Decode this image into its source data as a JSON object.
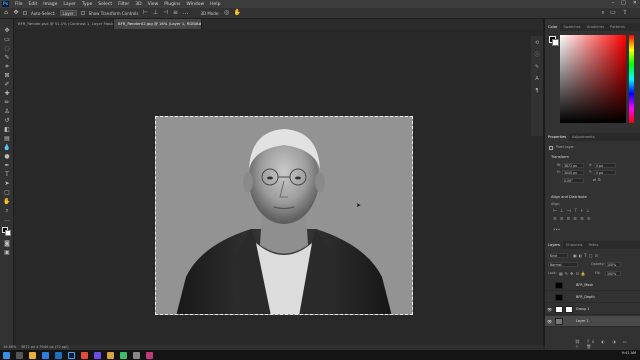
{
  "menubar": {
    "items": [
      "File",
      "Edit",
      "Image",
      "Layer",
      "Type",
      "Select",
      "Filter",
      "3D",
      "View",
      "Plugins",
      "Window",
      "Help"
    ],
    "logo": "Ps"
  },
  "options_bar": {
    "auto_select": "Auto-Select:",
    "auto_select_value": "Layer",
    "show_transform": "Show Transform Controls",
    "mode_3d": "3D Mode:"
  },
  "tabs": [
    {
      "label": "BFR_Render.psd @ 51.1% (Contrast 1, Layer Mask/8) *"
    },
    {
      "label": "BFR_Render02.jpg @ 16% (Layer 1, RGB/8#) *"
    }
  ],
  "statusbar": {
    "zoom": "16.66%",
    "doc_info": "3872 px x 3040 px (72 ppi)"
  },
  "color_panel": {
    "tabs": [
      "Color",
      "Swatches",
      "Gradients",
      "Patterns"
    ],
    "hue_accent": "#ff0000"
  },
  "properties_panel": {
    "tabs": [
      "Properties",
      "Adjustments"
    ],
    "layer_type": "Pixel Layer",
    "transform_title": "Transform",
    "w_label": "W:",
    "w_value": "3872 px",
    "h_label": "H:",
    "h_value": "3040 px",
    "x_label": "X:",
    "x_value": "0 px",
    "y_label": "Y:",
    "y_value": "0 px",
    "angle_value": "0.00°",
    "align_title": "Align and Distribute",
    "align_sub": "Align:"
  },
  "layers_panel": {
    "tabs": [
      "Layers",
      "Channels",
      "Paths"
    ],
    "kind": "Kind",
    "blend_mode": "Normal",
    "opacity_label": "Opacity:",
    "opacity_value": "100%",
    "lock_label": "Lock:",
    "fill_label": "Fill:",
    "fill_value": "100%",
    "layers": [
      {
        "name": "BFR_Mask",
        "visible": false,
        "selected": false
      },
      {
        "name": "BFR_Depth",
        "visible": false,
        "selected": false
      },
      {
        "name": "Group 1",
        "visible": true,
        "selected": false
      },
      {
        "name": "Layer 1",
        "visible": true,
        "selected": true
      }
    ]
  },
  "taskbar": {
    "time": "9:41 AM",
    "date": "1/1/2024"
  }
}
